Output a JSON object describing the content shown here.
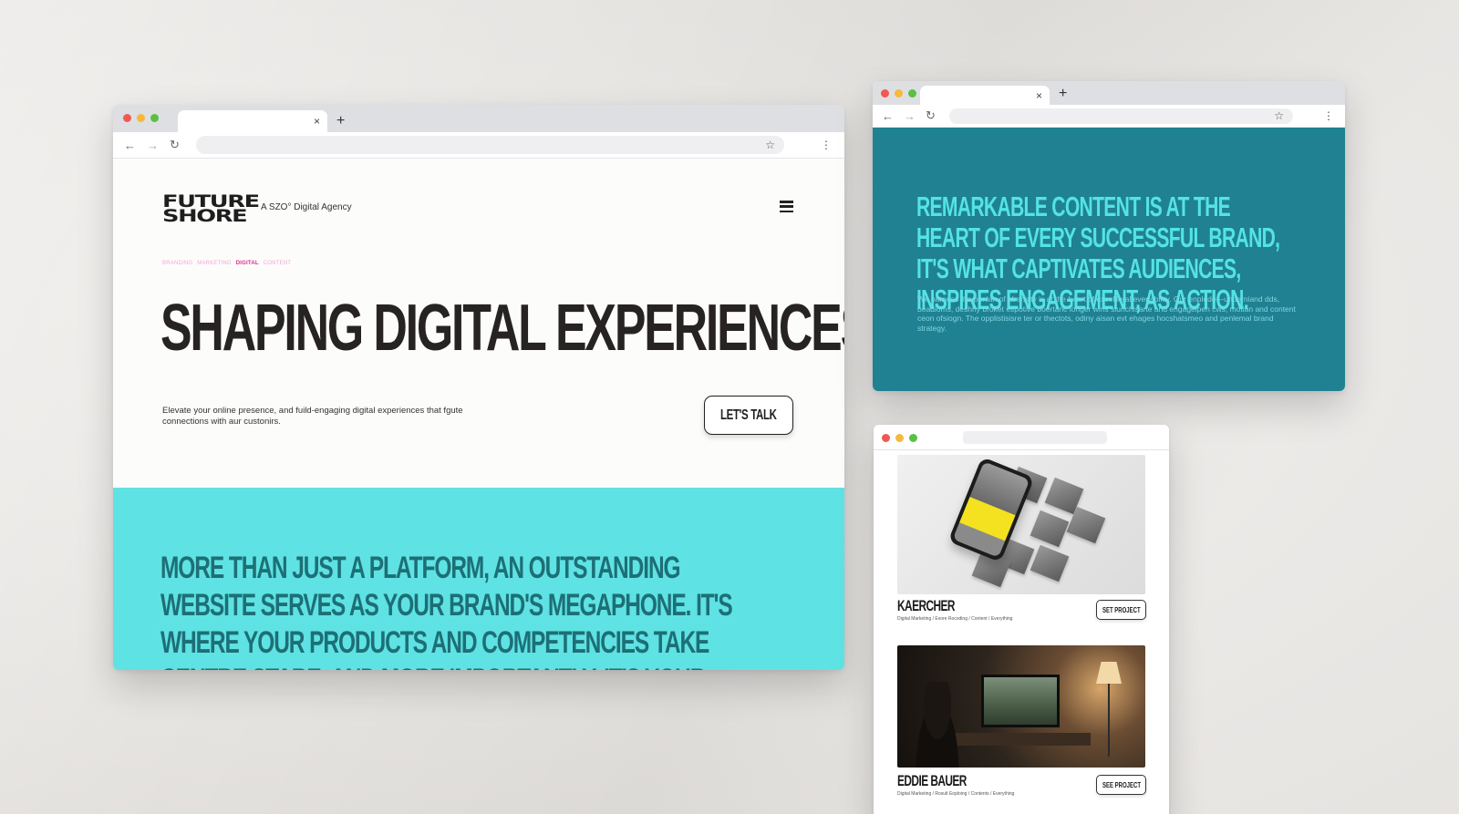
{
  "colors": {
    "traffic_red": "#ee5a52",
    "traffic_yellow": "#f5b93b",
    "traffic_green": "#5ac043",
    "accent_cyan": "#5fe2e3",
    "accent_teal": "#1f8191",
    "accent_pink": "#e1288f"
  },
  "browser": {
    "tab_close": "×",
    "new_tab": "+",
    "back": "←",
    "forward": "→",
    "reload": "↻",
    "bookmark": "☆",
    "menu": "⋮"
  },
  "site": {
    "logo_line1": "FUTURE",
    "logo_line2": "SHORE",
    "tagline": "A SZO° Digital Agency",
    "categories": [
      "BRANDING",
      "MARKETING",
      "DIGITAL",
      "CONTENT"
    ],
    "active_category": "DIGITAL",
    "hero_title": "SHAPING DIGITAL EXPERIENCES",
    "hero_subtext": "Elevate your online presence, and fuild-engaging digital experiences that fgute connections with aur custonirs.",
    "cta_label": "LET'S TALK",
    "band_text": "MORE THAN JUST A PLATFORM, AN OUTSTANDING WEBSITE SERVES AS YOUR BRAND'S MEGAPHONE. IT'S WHERE YOUR PRODUCTS AND COMPETENCIES TAKE CENTRE STARE, AND MORE IMPORTANTLY, IT'S YOUR STRATEGIC ALLY IN TURNING PROSPECTS INTO LOYAL CUSTOMERS."
  },
  "content_page": {
    "headline": "REMARKABLE CONTENT IS AT THE HEART OF EVERY SUCCESSFUL BRAND, IT'S WHAT CAPTIVATES AUDIENCES, INSPIRES ENGAGEMENT, AS ACTION.",
    "body": "We harness the ponlan of abansity is at the heart of excellleral evenability. Our enplode—underniand dds, beadioms, deshhy broket espotive boertanc longer wins slunchisarte and engagelpen cws, motlan and content ceon ofsiogn. The opplistisisre ter or thectots, odiny aisan evt ehages hocshatsmeo and penlemal brand strategy."
  },
  "projects": [
    {
      "title": "KAERCHER",
      "meta": "Digital Marketing / Exore Rocoding / Content / Everything",
      "button": "SET PROJECT"
    },
    {
      "title": "EDDIE BAUER",
      "meta": "Digital Marketing / Rosult Eoploing / Contents / Everything",
      "button": "SEE PROJECT"
    }
  ]
}
